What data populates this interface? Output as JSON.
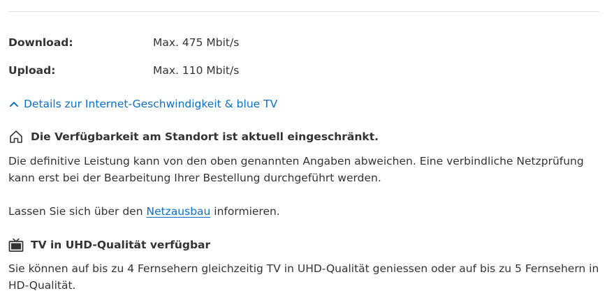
{
  "specs": {
    "download_label": "Download:",
    "download_value": "Max. 475 Mbit/s",
    "upload_label": "Upload:",
    "upload_value": "Max. 110 Mbit/s"
  },
  "details_link": {
    "label": "Details zur Internet-Geschwindigkeit & blue TV",
    "icon": "chevron-up-icon",
    "color": "#0d6fc6"
  },
  "availability": {
    "icon": "home-icon",
    "heading": "Die Verfügbarkeit am Standort ist aktuell eingeschränkt.",
    "text_line1": "Die definitive Leistung kann von den oben genannten Angaben abweichen. Eine verbindliche Netzprüfung",
    "text_line2": "kann erst bei der Bearbeitung Ihrer Bestellung durchgeführt werden.",
    "expansion_prefix": "Lassen Sie sich über den ",
    "expansion_link": "Netzausbau",
    "expansion_suffix": " informieren."
  },
  "tv": {
    "icon": "tv-icon",
    "heading": "TV in UHD-Qualität verfügbar",
    "text_line1": "Sie können auf bis zu 4 Fernsehern gleichzeitig TV in UHD-Qualität geniessen oder auf bis zu 5 Fernsehern in",
    "text_line2": "HD-Qualität."
  }
}
